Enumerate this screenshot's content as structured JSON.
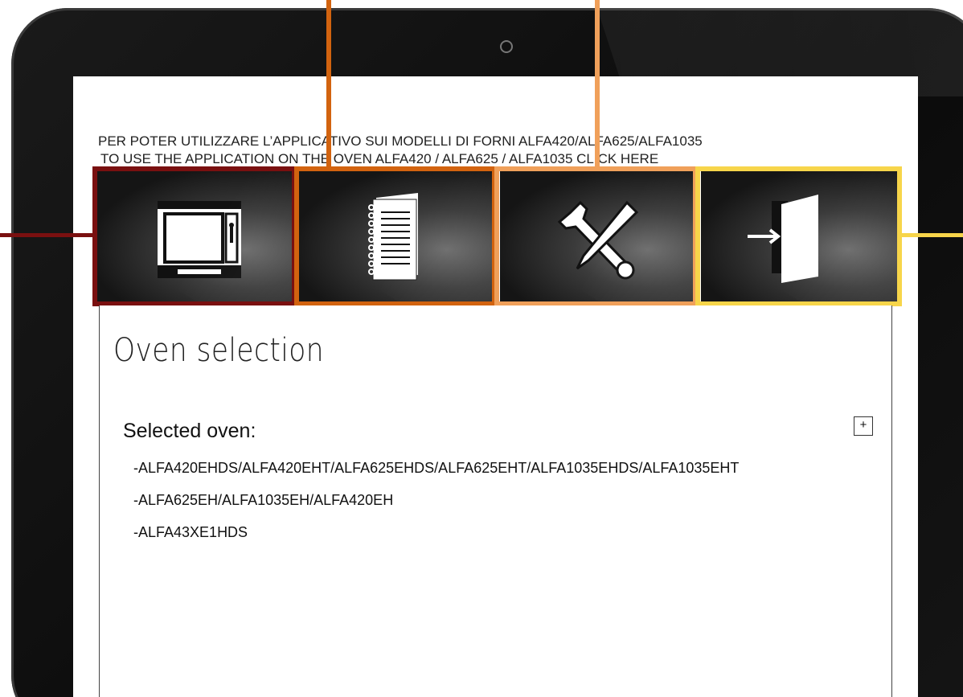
{
  "notice": {
    "italian": "PER POTER UTILIZZARE L’APPLICATIVO SUI MODELLI DI FORNI ALFA420/ALFA625/ALFA1035",
    "english": " TO USE THE APPLICATION ON THE OVEN ALFA420 / ALFA625 / ALFA1035 CLICK HERE"
  },
  "menu": [
    {
      "icon": "oven-icon",
      "color": "#7a1010"
    },
    {
      "icon": "notebook-icon",
      "color": "#d2630f"
    },
    {
      "icon": "tools-icon",
      "color": "#f0a05a"
    },
    {
      "icon": "exit-door-icon",
      "color": "#f7d54a"
    }
  ],
  "main": {
    "title": "Oven selection",
    "selected_label": "Selected oven:",
    "expand_label": "+",
    "ovens": [
      "-ALFA420EHDS/ALFA420EHT/ALFA625EHDS/ALFA625EHT/ALFA1035EHDS/ALFA1035EHT",
      "-ALFA625EH/ALFA1035EH/ALFA420EH",
      "-ALFA43XE1HDS"
    ]
  }
}
